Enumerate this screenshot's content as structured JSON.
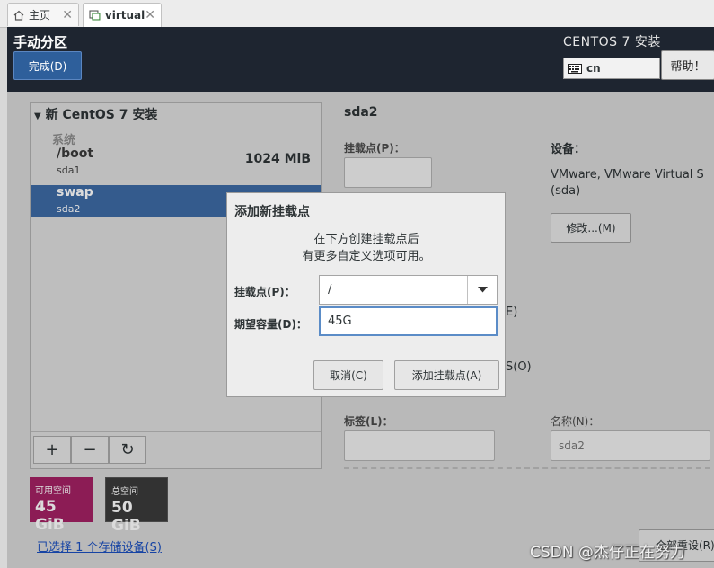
{
  "vm_tabs": [
    {
      "label": "主页",
      "icon": "home-icon",
      "close": "✕"
    },
    {
      "label": "virtual",
      "icon": "vm-icon",
      "close": "✕"
    }
  ],
  "header": {
    "title": "手动分区",
    "done_button": "完成(D)",
    "product": "CENTOS 7 安装",
    "keyboard_layout": "cn",
    "help_button": "帮助！"
  },
  "left_panel": {
    "install_title": "新 CentOS 7 安装",
    "system_label": "系统",
    "partitions": [
      {
        "mount": "/boot",
        "device": "sda1",
        "size": "1024 MiB"
      },
      {
        "mount": "swap",
        "device": "sda2",
        "size": ""
      }
    ],
    "toolbar": {
      "add": "+",
      "remove": "−",
      "refresh": "↻"
    },
    "available_label": "可用空间",
    "available_value": "45 GiB",
    "total_label": "总空间",
    "total_value": "50 GiB",
    "storage_link": "已选择 1 个存储设备(S)"
  },
  "right_panel": {
    "title": "sda2",
    "mount_label": "挂载点(P)：",
    "device_label": "设备：",
    "device_value": "VMware, VMware Virtual S (sda)",
    "modify_button": "修改...(M)",
    "frag_e": "E)",
    "frag_o": "S(O)",
    "tag_label": "标签(L)：",
    "name_label": "名称(N)：",
    "name_value": "sda2",
    "reset_button": "全部重设(R)"
  },
  "dialog": {
    "title": "添加新挂载点",
    "desc_line1": "在下方创建挂载点后",
    "desc_line2": "有更多自定义选项可用。",
    "mount_label": "挂载点(P)：",
    "mount_value": "/",
    "capacity_label": "期望容量(D)：",
    "capacity_value": "45G",
    "cancel_button": "取消(C)",
    "add_button": "添加挂载点(A)"
  },
  "watermark": "CSDN @杰仔正在努力",
  "colors": {
    "header_bg": "#1e2530",
    "selected_row": "#3d6aa5",
    "available_space": "#a32163",
    "total_space": "#3b3b3b"
  }
}
